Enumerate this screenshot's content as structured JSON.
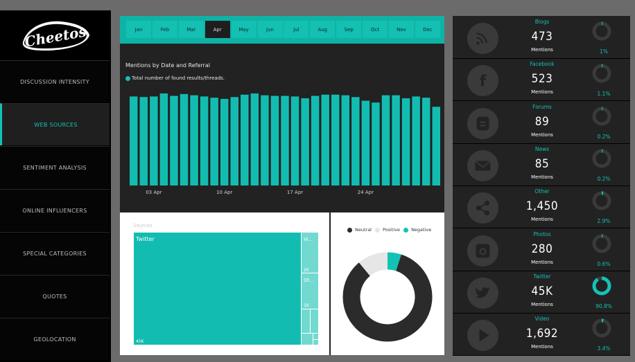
{
  "brand": {
    "name": "Cheetos",
    "accent": "#14c2b5"
  },
  "sidebar": {
    "items": [
      {
        "label": "DISCUSSION INTENSITY",
        "active": false
      },
      {
        "label": "WEB SOURCES",
        "active": true
      },
      {
        "label": "SENTIMENT ANALYSIS",
        "active": false
      },
      {
        "label": "ONLINE INFLUENCERS",
        "active": false
      },
      {
        "label": "SPECIAL CATEGORIES",
        "active": false
      },
      {
        "label": "QUOTES",
        "active": false
      },
      {
        "label": "GEOLOCATION",
        "active": false
      }
    ]
  },
  "months": {
    "items": [
      "Jan",
      "Feb",
      "Mar",
      "Apr",
      "May",
      "Jun",
      "Jul",
      "Aug",
      "Sep",
      "Oct",
      "Nov",
      "Dec"
    ],
    "selected": "Apr"
  },
  "mentions_chart": {
    "title": "Mentions by Date and Referral",
    "legend": "Total number of found results/threads."
  },
  "sources": {
    "title": "Sources",
    "twitter_label": "Twitter",
    "twitter_value": "45K",
    "video_label": "Vi...",
    "video_value": "2K",
    "other_label": "Ot...",
    "other_value": "1K"
  },
  "sentiment": {
    "legend": [
      {
        "label": "Neutral",
        "color": "#2b2b2b"
      },
      {
        "label": "Positive",
        "color": "#e6e6e6"
      },
      {
        "label": "Negative",
        "color": "#14c2b5"
      }
    ]
  },
  "web_sources": {
    "rows": [
      {
        "name": "Blogs",
        "value": "473",
        "sub": "Mentions",
        "pct": "1%",
        "icon": "rss-icon"
      },
      {
        "name": "Facebook",
        "value": "523",
        "sub": "Mentions",
        "pct": "1.1%",
        "icon": "facebook-icon"
      },
      {
        "name": "Forums",
        "value": "89",
        "sub": "Mentions",
        "pct": "0.2%",
        "icon": "blogger-icon"
      },
      {
        "name": "News",
        "value": "85",
        "sub": "Mentions",
        "pct": "0.2%",
        "icon": "envelope-icon"
      },
      {
        "name": "Other",
        "value": "1,450",
        "sub": "Mentions",
        "pct": "2.9%",
        "icon": "share-icon"
      },
      {
        "name": "Photos",
        "value": "280",
        "sub": "Mentions",
        "pct": "0.6%",
        "icon": "instagram-icon"
      },
      {
        "name": "Twitter",
        "value": "45K",
        "sub": "Mentions",
        "pct": "90.8%",
        "icon": "twitter-icon"
      },
      {
        "name": "Video",
        "value": "1,692",
        "sub": "Mentions",
        "pct": "3.4%",
        "icon": "play-icon"
      }
    ]
  },
  "chart_data": [
    {
      "type": "bar",
      "title": "Mentions by Date and Referral",
      "series": [
        {
          "name": "Total number of found results/threads.",
          "values": [
            1470,
            1460,
            1470,
            1520,
            1480,
            1510,
            1490,
            1470,
            1450,
            1430,
            1460,
            1500,
            1520,
            1490,
            1480,
            1480,
            1470,
            1440,
            1480,
            1500,
            1500,
            1490,
            1460,
            1400,
            1370,
            1490,
            1490,
            1440,
            1470,
            1450,
            1300
          ]
        }
      ],
      "x_tick_labels": [
        "03 Apr",
        "10 Apr",
        "17 Apr",
        "24 Apr"
      ],
      "x_tick_indices": [
        2,
        9,
        16,
        23
      ],
      "ylim": [
        0,
        1600
      ],
      "grid": false,
      "legend": "top-left"
    },
    {
      "type": "treemap",
      "title": "Sources",
      "categories": [
        "Twitter",
        "Video",
        "Other",
        "Blogs",
        "Facebook",
        "Photos",
        "Forums",
        "News"
      ],
      "values": [
        45000,
        1692,
        1450,
        473,
        523,
        280,
        89,
        85
      ]
    },
    {
      "type": "pie",
      "categories": [
        "Neutral",
        "Positive",
        "Negative"
      ],
      "values": [
        84,
        11,
        5
      ],
      "colors": [
        "#2b2b2b",
        "#e6e6e6",
        "#14c2b5"
      ],
      "legend": "top"
    }
  ]
}
